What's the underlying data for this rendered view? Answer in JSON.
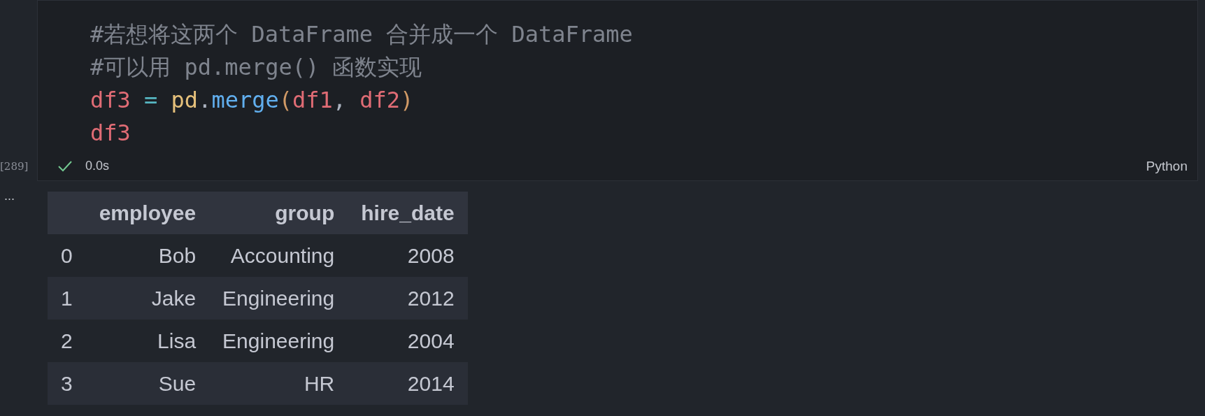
{
  "cell": {
    "execution_count": "[289]",
    "code_lines": [
      [
        {
          "kind": "comment",
          "text": "#若想将这两个 DataFrame 合并成一个 DataFrame"
        }
      ],
      [
        {
          "kind": "comment",
          "text": "#可以用 pd.merge() 函数实现"
        }
      ],
      [
        {
          "kind": "variable",
          "text": "df3"
        },
        {
          "kind": "operator",
          "text": " = "
        },
        {
          "kind": "module",
          "text": "pd"
        },
        {
          "kind": "plain",
          "text": "."
        },
        {
          "kind": "function",
          "text": "merge"
        },
        {
          "kind": "paren",
          "text": "("
        },
        {
          "kind": "variable",
          "text": "df1"
        },
        {
          "kind": "plain",
          "text": ", "
        },
        {
          "kind": "variable",
          "text": "df2"
        },
        {
          "kind": "paren",
          "text": ")"
        }
      ],
      [
        {
          "kind": "variable",
          "text": "df3"
        }
      ]
    ],
    "status": {
      "success": true,
      "duration": "0.0s"
    },
    "language": "Python"
  },
  "output": {
    "menu": "...",
    "table": {
      "columns": [
        "",
        "employee",
        "group",
        "hire_date"
      ],
      "rows": [
        [
          "0",
          "Bob",
          "Accounting",
          "2008"
        ],
        [
          "1",
          "Jake",
          "Engineering",
          "2012"
        ],
        [
          "2",
          "Lisa",
          "Engineering",
          "2004"
        ],
        [
          "3",
          "Sue",
          "HR",
          "2014"
        ]
      ]
    }
  }
}
